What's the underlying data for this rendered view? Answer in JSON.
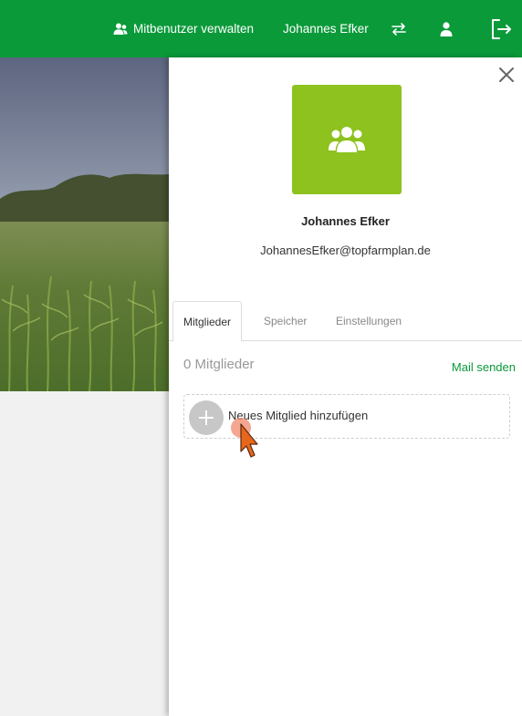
{
  "topbar": {
    "manage_users_label": "Mitbenutzer verwalten",
    "user_name": "Johannes Efker",
    "color": "#0b9a3a"
  },
  "panel": {
    "name": "Johannes Efker",
    "email": "JohannesEfker@topfarmplan.de",
    "avatar_color": "#8dc21f",
    "tabs": [
      {
        "label": "Mitglieder",
        "active": true
      },
      {
        "label": "Speicher",
        "active": false
      },
      {
        "label": "Einstellungen",
        "active": false
      }
    ],
    "member_count": "0 Mitglieder",
    "mail_label": "Mail senden",
    "add_member_label": "Neues Mitglied hinzufügen"
  }
}
